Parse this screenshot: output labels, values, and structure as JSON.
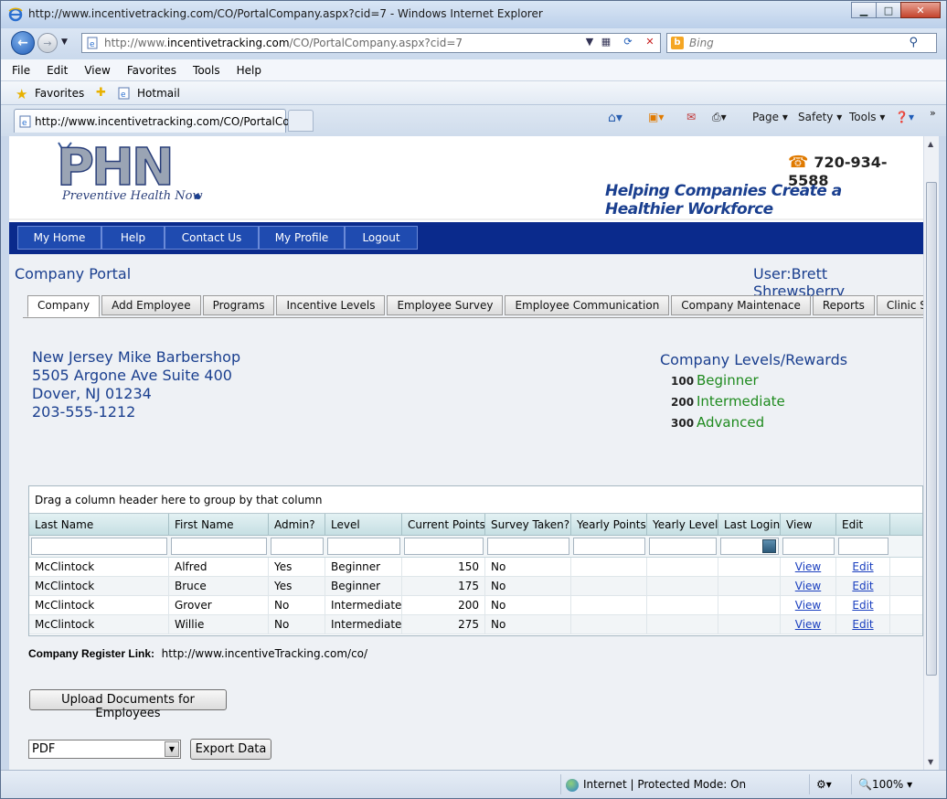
{
  "window": {
    "title": "http://www.incentivetracking.com/CO/PortalCompany.aspx?cid=7 - Windows Internet Explorer",
    "minimize": "▁",
    "maximize": "□",
    "close": "✕"
  },
  "address": {
    "url_prefix": "http://www.",
    "url_host": "incentivetracking.com",
    "url_path": "/CO/PortalCompany.aspx?cid=7",
    "search_placeholder": "Bing"
  },
  "menu": [
    "File",
    "Edit",
    "View",
    "Favorites",
    "Tools",
    "Help"
  ],
  "favorites": {
    "label": "Favorites",
    "hotmail": "Hotmail"
  },
  "browser_tab": {
    "label": "http://www.incentivetracking.com/CO/PortalCo..."
  },
  "command_bar": {
    "page": "Page ▾",
    "safety": "Safety ▾",
    "tools": "Tools ▾"
  },
  "header": {
    "logo_letters": "PHN",
    "logo_sub": "Preventive Health Now",
    "phone": "720-934-5588",
    "tagline": "Helping Companies Create a Healthier Workforce"
  },
  "nav": [
    "My Home",
    "Help",
    "Contact Us",
    "My Profile",
    "Logout"
  ],
  "portal": {
    "title": "Company Portal",
    "user": "User:Brett Shrewsberry"
  },
  "tabs": [
    "Company",
    "Add Employee",
    "Programs",
    "Incentive Levels",
    "Employee Survey",
    "Employee Communication",
    "Company Maintenace",
    "Reports",
    "Clinic Signups"
  ],
  "company": {
    "name": "New Jersey Mike Barbershop",
    "street": "5505 Argone Ave Suite 400",
    "city": "Dover, NJ 01234",
    "phone": "203-555-1212"
  },
  "levels": {
    "title": "Company Levels/Rewards",
    "items": [
      {
        "points": "100",
        "name": "Beginner"
      },
      {
        "points": "200",
        "name": "Intermediate"
      },
      {
        "points": "300",
        "name": "Advanced"
      }
    ]
  },
  "grid": {
    "group_hint": "Drag a column header here to group by that column",
    "columns": [
      "Last Name",
      "First Name",
      "Admin?",
      "Level",
      "Current Points",
      "Survey Taken?",
      "Yearly Points",
      "Yearly Level",
      "Last Login",
      "View",
      "Edit"
    ],
    "rows": [
      {
        "last": "McClintock",
        "first": "Alfred",
        "admin": "Yes",
        "level": "Beginner",
        "points": "150",
        "survey": "No",
        "yp": "",
        "yl": "",
        "login": "",
        "view": "View",
        "edit": "Edit"
      },
      {
        "last": "McClintock",
        "first": "Bruce",
        "admin": "Yes",
        "level": "Beginner",
        "points": "175",
        "survey": "No",
        "yp": "",
        "yl": "",
        "login": "",
        "view": "View",
        "edit": "Edit"
      },
      {
        "last": "McClintock",
        "first": "Grover",
        "admin": "No",
        "level": "Intermediate",
        "points": "200",
        "survey": "No",
        "yp": "",
        "yl": "",
        "login": "",
        "view": "View",
        "edit": "Edit"
      },
      {
        "last": "McClintock",
        "first": "Willie",
        "admin": "No",
        "level": "Intermediate",
        "points": "275",
        "survey": "No",
        "yp": "",
        "yl": "",
        "login": "",
        "view": "View",
        "edit": "Edit"
      }
    ]
  },
  "register": {
    "label": "Company Register Link:",
    "url": "http://www.incentiveTracking.com/co/"
  },
  "upload_label": "Upload Documents for Employees",
  "export": {
    "format": "PDF",
    "button": "Export Data"
  },
  "status": {
    "zone": "Internet | Protected Mode: On",
    "zoom": "100%"
  }
}
